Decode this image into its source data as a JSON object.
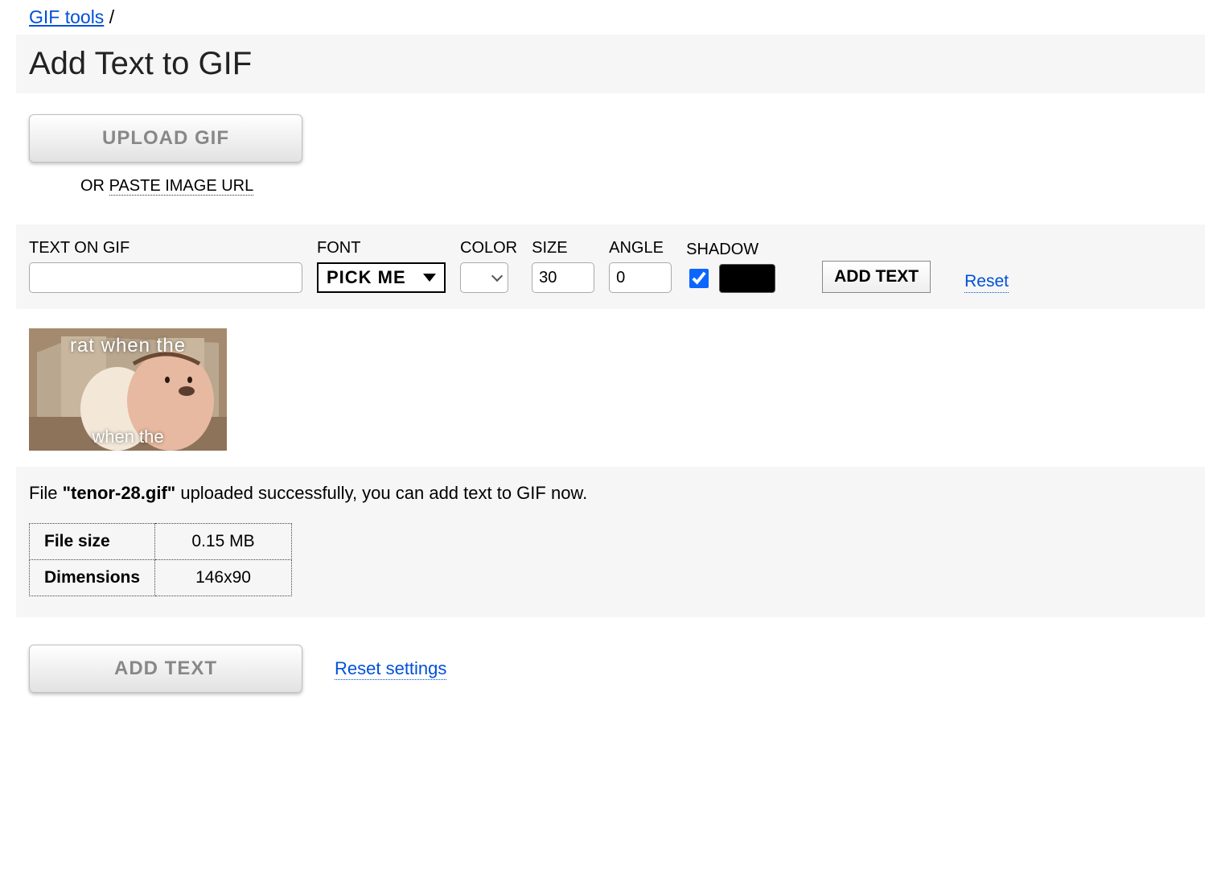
{
  "breadcrumb": {
    "link": "GIF tools",
    "sep": " /"
  },
  "title": "Add Text to GIF",
  "upload_button": "UPLOAD GIF",
  "or_paste": {
    "prefix": "OR ",
    "link": "PASTE IMAGE URL"
  },
  "controls": {
    "text_label": "TEXT ON GIF",
    "text_value": "",
    "font_label": "FONT",
    "font_value": "PICK ME",
    "color_label": "COLOR",
    "size_label": "SIZE",
    "size_value": "30",
    "angle_label": "ANGLE",
    "angle_value": "0",
    "shadow_label": "SHADOW",
    "shadow_checked": true,
    "shadow_color": "#000000",
    "add_text_button": "ADD TEXT",
    "reset_link": "Reset"
  },
  "preview": {
    "caption_top": "rat when the",
    "caption_bottom": "when the"
  },
  "status": {
    "prefix": "File ",
    "filename": "\"tenor-28.gif\"",
    "suffix": " uploaded successfully, you can add text to GIF now."
  },
  "file_info": {
    "rows": [
      {
        "label": "File size",
        "value": "0.15 MB"
      },
      {
        "label": "Dimensions",
        "value": "146x90"
      }
    ]
  },
  "bottom": {
    "add_text": "ADD TEXT",
    "reset_settings": "Reset settings"
  }
}
